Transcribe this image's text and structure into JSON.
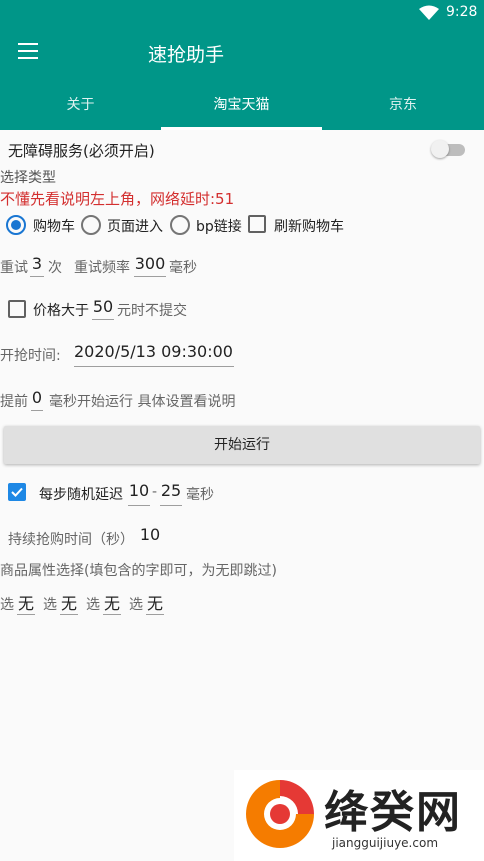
{
  "status": {
    "time": "9:28"
  },
  "toolbar": {
    "title": "速抢助手"
  },
  "tabs": [
    {
      "label": "关于",
      "active": false
    },
    {
      "label": "淘宝天猫",
      "active": true
    },
    {
      "label": "京东",
      "active": false
    }
  ],
  "accessibility": {
    "label": "无障碍服务(必须开启)",
    "enabled": false
  },
  "select_type": {
    "label": "选择类型",
    "warning": "不懂先看说明左上角，网络延时:51",
    "options": [
      "购物车",
      "页面进入",
      "bp链接"
    ],
    "selected": "购物车",
    "refresh_cart_label": "刷新购物车",
    "refresh_cart_checked": false
  },
  "retry": {
    "label": "重试",
    "count": "3",
    "count_unit": "次",
    "freq_label": "重试频率",
    "freq": "300",
    "freq_unit": "毫秒"
  },
  "price": {
    "checked": false,
    "label": "价格大于",
    "value": "50",
    "suffix": "元时不提交"
  },
  "start_time": {
    "label": "开抢时间:",
    "value": "2020/5/13 09:30:00"
  },
  "advance": {
    "prefix": "提前",
    "value": "0",
    "suffix": "毫秒开始运行 具体设置看说明"
  },
  "start_button": "开始运行",
  "random_delay": {
    "checked": true,
    "label": "每步随机延迟",
    "min": "10",
    "sep": "-",
    "max": "25",
    "unit": "毫秒"
  },
  "duration": {
    "label": "持续抢购时间（秒）",
    "value": "10"
  },
  "attributes": {
    "label": "商品属性选择(填包含的字即可，为无即跳过)",
    "prefix": "选",
    "values": [
      "无",
      "无",
      "无",
      "无"
    ]
  },
  "watermark": {
    "brand": "绛癸网",
    "url": "jiangguijiuye.com"
  },
  "colors": {
    "primary": "#009688",
    "warning": "#d32f2f",
    "accent": "#1e88e5"
  }
}
